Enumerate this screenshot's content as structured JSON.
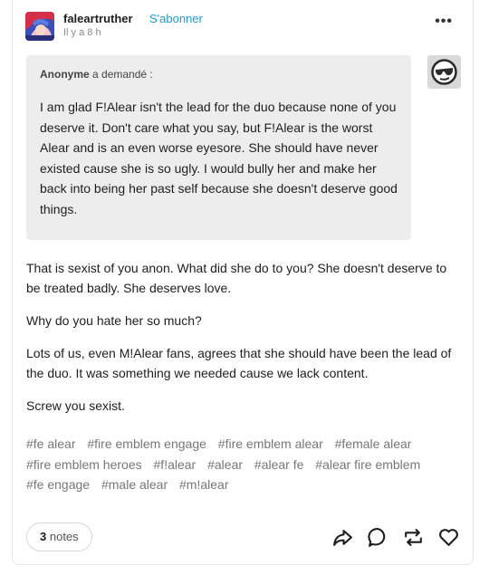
{
  "post": {
    "blog_name": "faleartruther",
    "follow_label": "S'abonner",
    "timestamp": "Il y a 8 h",
    "more_label": "•••"
  },
  "ask": {
    "asker_name": "Anonyme",
    "asker_suffix": "a demandé :",
    "text": "I am glad F!Alear isn't the lead for the duo because none of you deserve it. Don't care what you say, but F!Alear is the worst Alear and is an even worse eyesore. She should have never existed cause she is so ugly. I would bully her and make her back into being her past self because she doesn't deserve good things."
  },
  "answer": {
    "paragraphs": [
      "That is sexist of you anon. What did she do to you? She doesn't deserve to be treated badly. She deserves love.",
      "Why do you hate her so much?",
      "Lots of us, even M!Alear fans, agrees that she should have been the lead of the duo. It was something we needed cause we lack content.",
      "Screw you sexist."
    ]
  },
  "tags": [
    "#fe alear",
    "#fire emblem engage",
    "#fire emblem alear",
    "#female alear",
    "#fire emblem heroes",
    "#f!alear",
    "#alear",
    "#alear fe",
    "#alear fire emblem",
    "#fe engage",
    "#male alear",
    "#m!alear"
  ],
  "footer": {
    "notes_count": "3",
    "notes_label": "notes"
  },
  "icons": {
    "share": "share-icon",
    "reply": "reply-icon",
    "reblog": "reblog-icon",
    "like": "heart-icon"
  },
  "colors": {
    "follow": "#1d9bd1",
    "ask_background": "#ededed",
    "tag": "#777777"
  }
}
